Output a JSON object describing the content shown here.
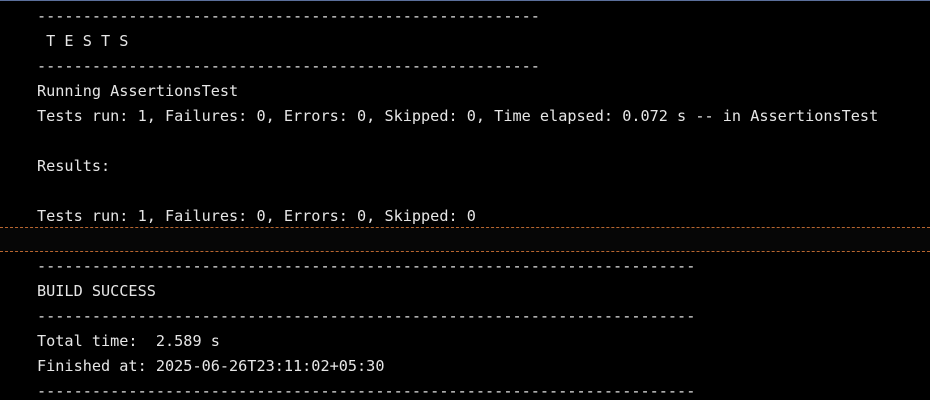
{
  "console": {
    "lines": [
      "-------------------------------------------------------",
      " T E S T S",
      "-------------------------------------------------------",
      "Running AssertionsTest",
      "Tests run: 1, Failures: 0, Errors: 0, Skipped: 0, Time elapsed: 0.072 s -- in AssertionsTest",
      "",
      "Results:",
      "",
      "Tests run: 1, Failures: 0, Errors: 0, Skipped: 0",
      "------------------------------------------------------------------------",
      "BUILD SUCCESS",
      "------------------------------------------------------------------------",
      "Total time:  2.589 s",
      "Finished at: 2025-06-26T23:11:02+05:30",
      "------------------------------------------------------------------------"
    ]
  },
  "colors": {
    "background": "#000000",
    "text": "#e6e6e6",
    "separator_band_border": "#b8662f",
    "window_top_border": "#5b6f9b"
  }
}
